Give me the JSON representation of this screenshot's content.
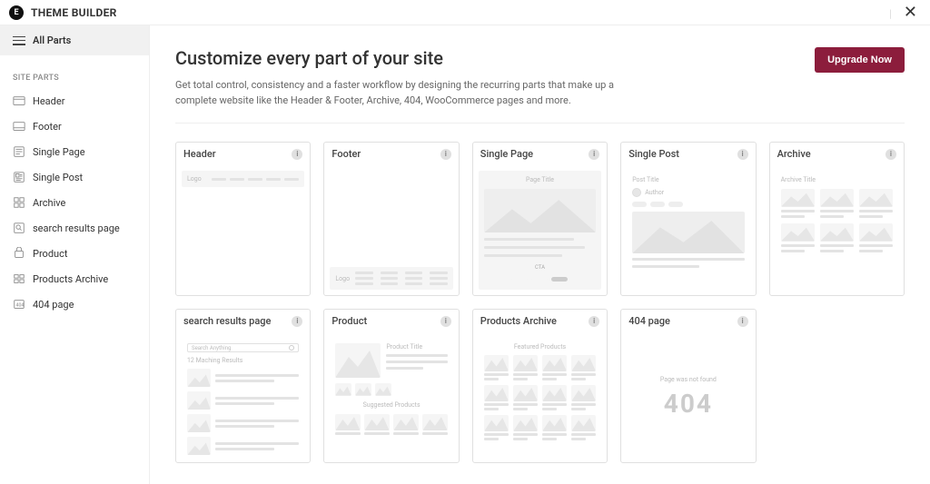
{
  "app": {
    "brand": "THEME BUILDER"
  },
  "sidebar": {
    "all_parts": "All Parts",
    "heading": "SITE PARTS",
    "items": [
      {
        "label": "Header"
      },
      {
        "label": "Footer"
      },
      {
        "label": "Single Page"
      },
      {
        "label": "Single Post"
      },
      {
        "label": "Archive"
      },
      {
        "label": "search results page"
      },
      {
        "label": "Product"
      },
      {
        "label": "Products Archive"
      },
      {
        "label": "404 page"
      }
    ]
  },
  "main": {
    "title": "Customize every part of your site",
    "desc": "Get total control, consistency and a faster workflow by designing the recurring parts that make up a complete website like the Header & Footer, Archive, 404, WooCommerce pages and more.",
    "upgrade": "Upgrade Now"
  },
  "cards": {
    "header": {
      "title": "Header",
      "logo": "Logo"
    },
    "footer": {
      "title": "Footer",
      "logo": "Logo"
    },
    "single_page": {
      "title": "Single Page",
      "page_title": "Page Title",
      "cta": "CTA"
    },
    "single_post": {
      "title": "Single Post",
      "post_title": "Post Title",
      "author": "Author"
    },
    "archive": {
      "title": "Archive",
      "archive_title": "Archive Title"
    },
    "search": {
      "title": "search results page",
      "placeholder": "Search Anything",
      "matching": "12 Maching Results"
    },
    "product": {
      "title": "Product",
      "product_title": "Product Title",
      "suggested": "Suggested Products"
    },
    "products_archive": {
      "title": "Products Archive",
      "featured": "Featured Products"
    },
    "notfound": {
      "title": "404 page",
      "msg": "Page was not found",
      "code": "404"
    }
  }
}
